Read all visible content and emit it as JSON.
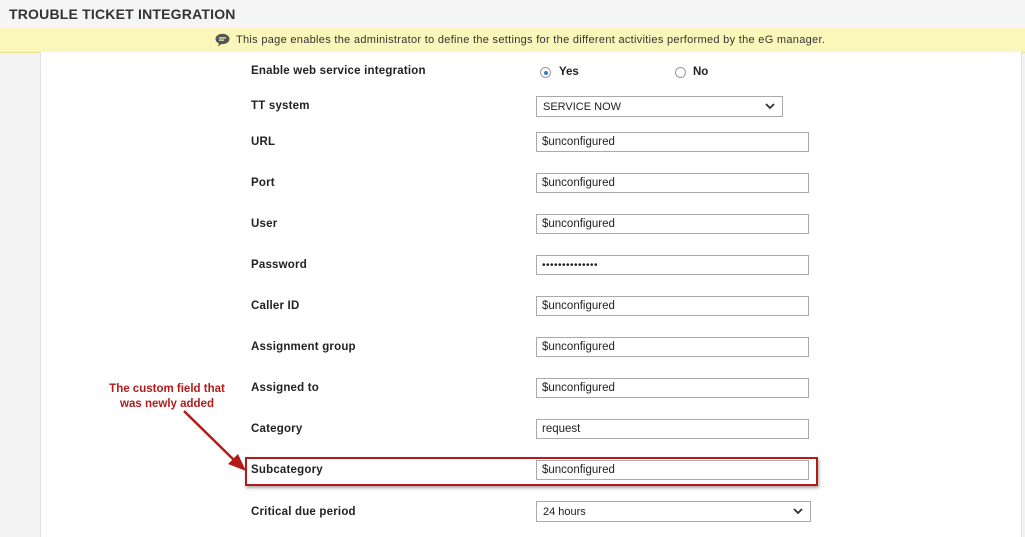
{
  "header": {
    "title": "TROUBLE TICKET INTEGRATION"
  },
  "info": {
    "message": "This page enables the administrator to define the settings for the different activities performed by the eG manager."
  },
  "form": {
    "enable_label": "Enable web service integration",
    "enable_options": {
      "yes": "Yes",
      "no": "No",
      "selected": "Yes"
    },
    "tt_system_label": "TT system",
    "tt_system_value": "SERVICE NOW",
    "url_label": "URL",
    "url_value": "$unconfigured",
    "port_label": "Port",
    "port_value": "$unconfigured",
    "user_label": "User",
    "user_value": "$unconfigured",
    "password_label": "Password",
    "password_value": "••••••••••••••",
    "caller_label": "Caller ID",
    "caller_value": "$unconfigured",
    "group_label": "Assignment group",
    "group_value": "$unconfigured",
    "assigned_label": "Assigned to",
    "assigned_value": "$unconfigured",
    "category_label": "Category",
    "category_value": "request",
    "subcategory_label": "Subcategory",
    "subcategory_value": "$unconfigured",
    "critical_label": "Critical due period",
    "critical_value": "24 hours"
  },
  "annotation": {
    "line1": "The custom field that",
    "line2": "was newly added",
    "color": "#b31b1b"
  }
}
